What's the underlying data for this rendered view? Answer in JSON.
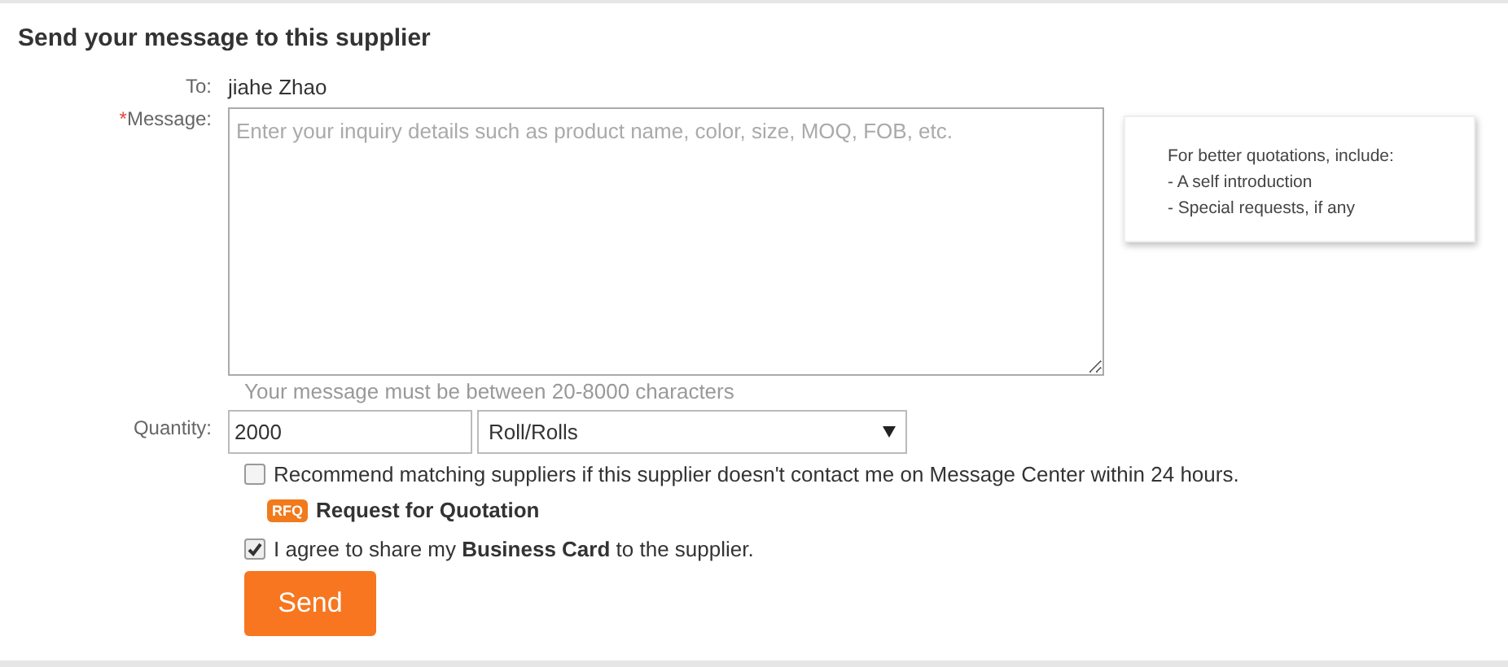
{
  "title": "Send your message to this supplier",
  "to": {
    "label": "To:",
    "value": "jiahe Zhao"
  },
  "message": {
    "required_mark": "*",
    "label": "Message:",
    "placeholder": "Enter your inquiry details such as product name, color, size, MOQ, FOB, etc.",
    "hint": "Your message must be between 20-8000 characters"
  },
  "tip": {
    "lines": [
      "For better quotations, include:",
      "- A self introduction",
      "- Special requests, if any"
    ]
  },
  "quantity": {
    "label": "Quantity:",
    "value": "2000",
    "unit": "Roll/Rolls"
  },
  "recommend": {
    "checked": false,
    "text": "Recommend matching suppliers if this supplier doesn't contact me on Message Center within 24 hours.",
    "badge": "RFQ",
    "link": "Request for Quotation"
  },
  "agree": {
    "checked": true,
    "text": "I agree to share my **Business Card** to the supplier."
  },
  "send_button": "Send"
}
